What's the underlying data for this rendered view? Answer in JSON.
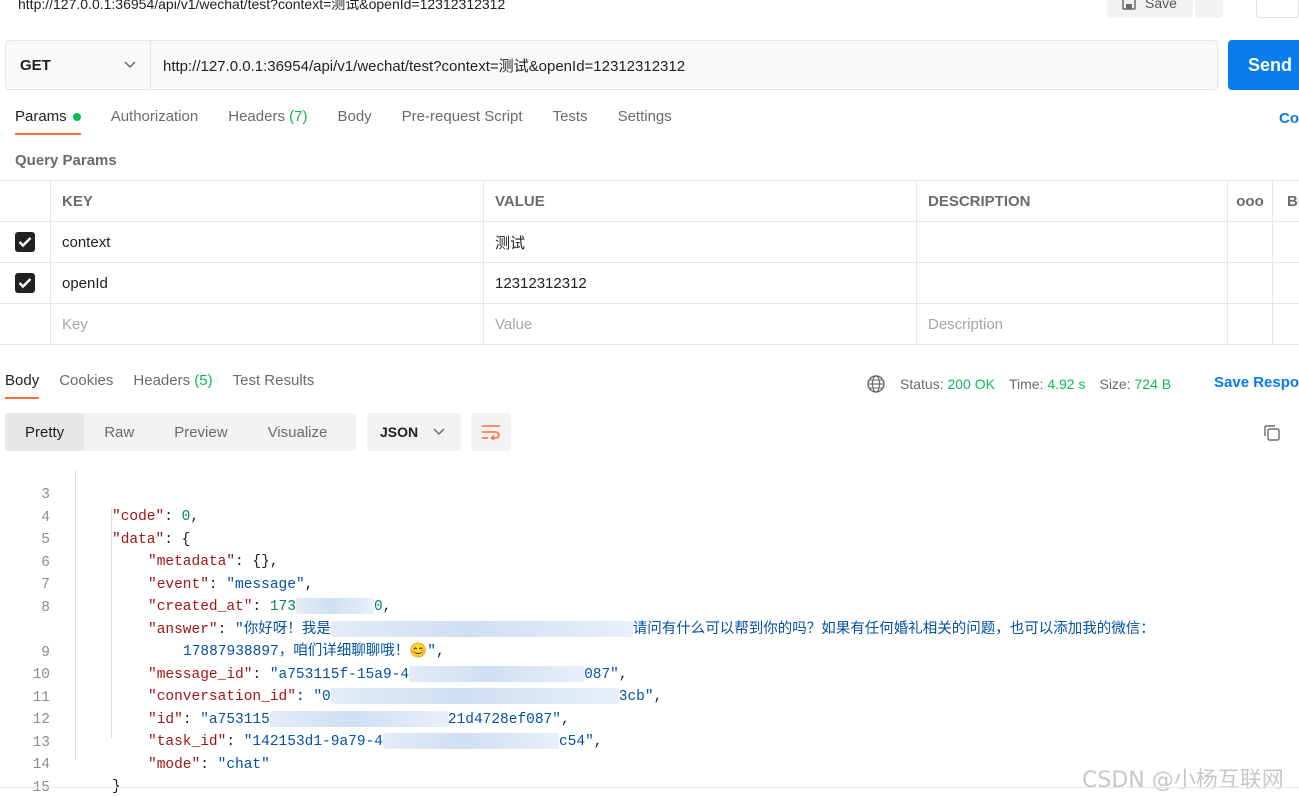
{
  "topbar": {
    "url_title": "http://127.0.0.1:36954/api/v1/wechat/test?context=测试&openId=12312312312",
    "save_label": "Save"
  },
  "request": {
    "method": "GET",
    "url": "http://127.0.0.1:36954/api/v1/wechat/test?context=测试&openId=12312312312",
    "send_label": "Send"
  },
  "req_tabs": {
    "params": "Params",
    "authorization": "Authorization",
    "headers": "Headers",
    "headers_count": "(7)",
    "body": "Body",
    "prerequest": "Pre-request Script",
    "tests": "Tests",
    "settings": "Settings",
    "cookies": "Co"
  },
  "query_params": {
    "title": "Query Params",
    "headers": {
      "key": "KEY",
      "value": "VALUE",
      "description": "DESCRIPTION",
      "more": "ooo",
      "bulk": "Bu"
    },
    "rows": [
      {
        "key": "context",
        "value": "测试",
        "description": ""
      },
      {
        "key": "openId",
        "value": "12312312312",
        "description": ""
      }
    ],
    "placeholders": {
      "key": "Key",
      "value": "Value",
      "description": "Description"
    }
  },
  "response": {
    "tabs": {
      "body": "Body",
      "cookies": "Cookies",
      "headers": "Headers",
      "headers_count": "(5)",
      "test_results": "Test Results"
    },
    "status_label": "Status:",
    "status_value": "200 OK",
    "time_label": "Time:",
    "time_value": "4.92 s",
    "size_label": "Size:",
    "size_value": "724 B",
    "save_response": "Save Respo",
    "view_modes": {
      "pretty": "Pretty",
      "raw": "Raw",
      "preview": "Preview",
      "visualize": "Visualize"
    },
    "format": "JSON"
  },
  "code": {
    "line_numbers": [
      "3",
      "4",
      "5",
      "6",
      "7",
      "8",
      "",
      "9",
      "10",
      "11",
      "12",
      "13",
      "14",
      "15"
    ],
    "code_key": "\"code\"",
    "code_val": "0",
    "data_key": "\"data\"",
    "metadata_key": "\"metadata\"",
    "metadata_val": "{}",
    "event_key": "\"event\"",
    "event_val": "\"message\"",
    "created_key": "\"created_at\"",
    "created_val_a": "173",
    "created_val_b": "0",
    "answer_key": "\"answer\"",
    "answer_val_a": "\"你好呀！我是",
    "answer_val_b": "请问有什么可以帮到你的吗？如果有任何婚礼相关的问题，也可以添加我的微信：",
    "answer_val_c": "17887938897，咱们详细聊聊哦！😊\"",
    "message_id_key": "\"message_id\"",
    "message_id_a": "\"a753115f-15a9-4",
    "message_id_b": "087\"",
    "conv_key": "\"conversation_id\"",
    "conv_a": "\"0",
    "conv_b": "3cb\"",
    "id_key": "\"id\"",
    "id_a": "\"a753115",
    "id_b": "21d4728ef087\"",
    "task_key": "\"task_id\"",
    "task_a": "\"142153d1-9a79-4",
    "task_b": "c54\"",
    "mode_key": "\"mode\"",
    "mode_val": "\"chat\""
  },
  "watermark": "CSDN @小杨互联网",
  "colors": {
    "accent": "#ff6c37",
    "send": "#097bed",
    "success": "#0cbb52"
  }
}
